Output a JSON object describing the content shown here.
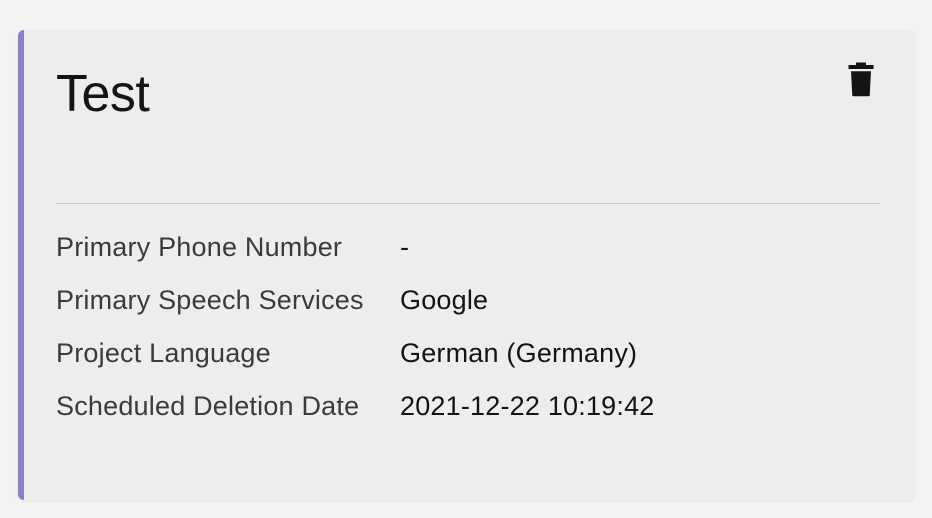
{
  "card": {
    "title": "Test",
    "details": {
      "primaryPhoneNumber": {
        "label": "Primary Phone Number",
        "value": "-"
      },
      "primarySpeechServices": {
        "label": "Primary Speech Services",
        "value": "Google"
      },
      "projectLanguage": {
        "label": "Project Language",
        "value": "German (Germany)"
      },
      "scheduledDeletionDate": {
        "label": "Scheduled Deletion Date",
        "value": "2021-12-22 10:19:42"
      }
    }
  },
  "icons": {
    "trash": "trash-icon"
  }
}
